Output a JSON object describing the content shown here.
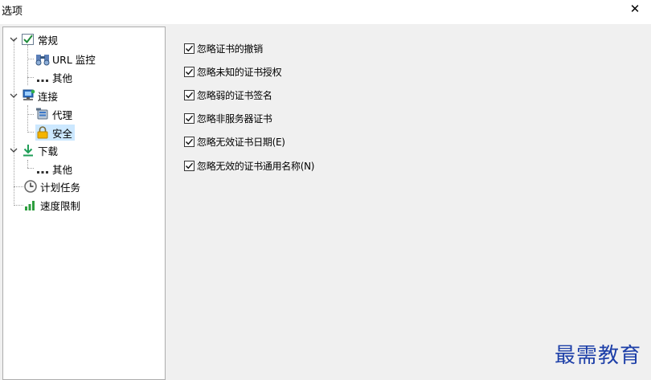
{
  "window": {
    "title": "选项",
    "close_glyph": "✕"
  },
  "tree": {
    "items": [
      {
        "label": "常规",
        "icon": "general-check-icon",
        "expanded": true
      },
      {
        "label": "URL 监控",
        "icon": "url-monitor-icon"
      },
      {
        "label": "其他",
        "icon": "dots-icon"
      },
      {
        "label": "连接",
        "icon": "network-computer-icon",
        "expanded": true
      },
      {
        "label": "代理",
        "icon": "proxy-icon"
      },
      {
        "label": "安全",
        "icon": "lock-icon",
        "selected": true
      },
      {
        "label": "下载",
        "icon": "download-arrow-icon",
        "expanded": true
      },
      {
        "label": "其他",
        "icon": "dots-icon"
      },
      {
        "label": "计划任务",
        "icon": "clock-icon"
      },
      {
        "label": "速度限制",
        "icon": "speed-bars-icon"
      }
    ]
  },
  "security_options": [
    {
      "label": "忽略证书的撤销",
      "checked": true
    },
    {
      "label": "忽略未知的证书授权",
      "checked": true
    },
    {
      "label": "忽略弱的证书签名",
      "checked": true
    },
    {
      "label": "忽略非服务器证书",
      "checked": true
    },
    {
      "label": "忽略无效证书日期(E)",
      "checked": true
    },
    {
      "label": "忽略无效的证书通用名称(N)",
      "checked": true
    }
  ],
  "watermark": "最需教育",
  "colors": {
    "selection": "#cce8ff",
    "watermark": "#1d3fa8"
  }
}
